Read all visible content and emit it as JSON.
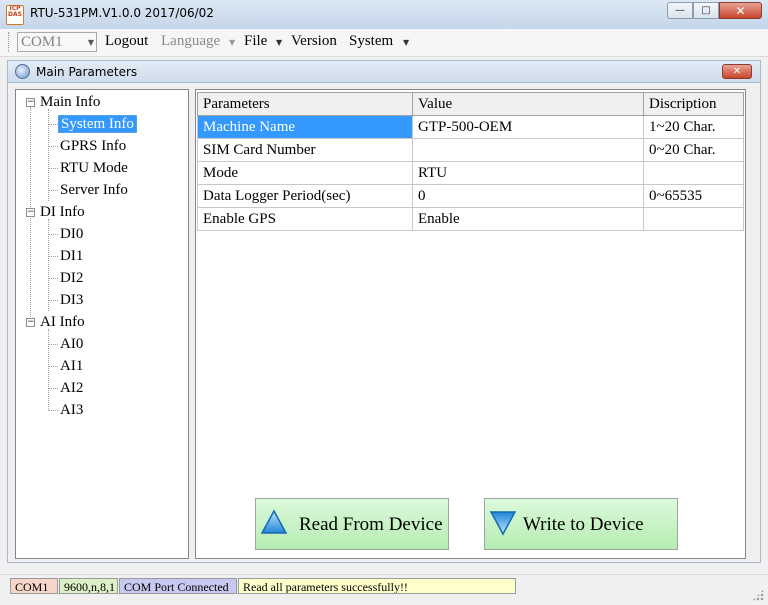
{
  "window": {
    "title": "RTU-531PM.V1.0.0 2017/06/02",
    "app_icon_text": "ICP DAS",
    "minimize_glyph": "—",
    "maximize_glyph": "□",
    "close_glyph": "✕"
  },
  "menubar": {
    "com_port": "COM1",
    "items": [
      {
        "label": "Logout",
        "has_arrow": false,
        "disabled": false
      },
      {
        "label": "Language",
        "has_arrow": true,
        "disabled": true
      },
      {
        "label": "File",
        "has_arrow": true,
        "disabled": false
      },
      {
        "label": "Version",
        "has_arrow": false,
        "disabled": false
      },
      {
        "label": "System",
        "has_arrow": true,
        "disabled": false
      }
    ],
    "arrow_glyph": "▼"
  },
  "child_window": {
    "title": "Main Parameters",
    "close_glyph": "✕"
  },
  "tree": {
    "groups": [
      {
        "label": "Main Info",
        "expander": "−",
        "children": [
          "System Info",
          "GPRS Info",
          "RTU Mode",
          "Server Info"
        ]
      },
      {
        "label": "DI Info",
        "expander": "−",
        "children": [
          "DI0",
          "DI1",
          "DI2",
          "DI3"
        ]
      },
      {
        "label": "AI Info",
        "expander": "−",
        "children": [
          "AI0",
          "AI1",
          "AI2",
          "AI3"
        ]
      }
    ],
    "selected": "System Info"
  },
  "grid": {
    "columns": [
      "Parameters",
      "Value",
      "Discription"
    ],
    "rows": [
      [
        "Machine Name",
        "GTP-500-OEM",
        "1~20 Char."
      ],
      [
        "SIM Card Number",
        "",
        "0~20 Char."
      ],
      [
        "Mode",
        "RTU",
        ""
      ],
      [
        "Data Logger Period(sec)",
        "0",
        "0~65535"
      ],
      [
        "Enable GPS",
        "Enable",
        ""
      ]
    ]
  },
  "buttons": {
    "read": "Read From Device",
    "write": "Write to Device"
  },
  "status": {
    "port": "COM1",
    "settings": "9600,n,8,1",
    "connection": "COM Port Connected",
    "message": "Read all parameters successfully!!"
  },
  "colors": {
    "selection": "#3399ff",
    "button_green": "#c8f4c4",
    "status_message_bg": "#ffffcc",
    "status_connection_bg": "#c8c8f0",
    "status_port_bg": "#f5d6c8",
    "status_settings_bg": "#dcf0c8"
  }
}
